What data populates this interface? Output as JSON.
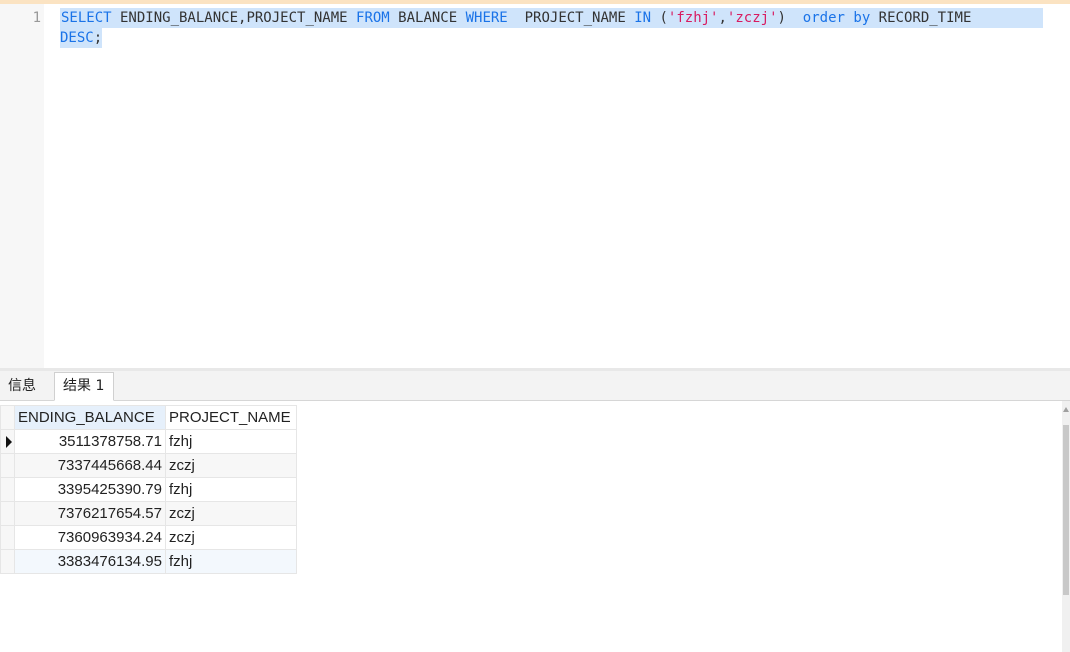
{
  "editor": {
    "line_number": "1",
    "sql": {
      "select_kw": "SELECT",
      "columns": " ENDING_BALANCE,PROJECT_NAME ",
      "from_kw": "FROM",
      "table": " BALANCE ",
      "where_kw": "WHERE",
      "where_col": "  PROJECT_NAME ",
      "in_kw": "IN",
      "paren_open": " (",
      "str1": "'fzhj'",
      "comma": ",",
      "str2": "'zczj'",
      "paren_close": ")  ",
      "order_kw": "order",
      "space": " ",
      "by_kw": "by",
      "order_col": " RECORD_TIME",
      "desc_kw": "DESC",
      "semicolon": ";"
    }
  },
  "tabs": {
    "info": "信息",
    "result": "结果 1"
  },
  "grid": {
    "columns": [
      "ENDING_BALANCE",
      "PROJECT_NAME"
    ],
    "rows": [
      [
        "3511378758.71",
        "fzhj"
      ],
      [
        "7337445668.44",
        "zczj"
      ],
      [
        "3395425390.79",
        "fzhj"
      ],
      [
        "7376217654.57",
        "zczj"
      ],
      [
        "7360963934.24",
        "zczj"
      ],
      [
        "3383476134.95",
        "fzhj"
      ]
    ]
  },
  "colors": {
    "keyword": "#1a73e8",
    "string": "#d81b60",
    "selection": "#cfe4fb"
  }
}
